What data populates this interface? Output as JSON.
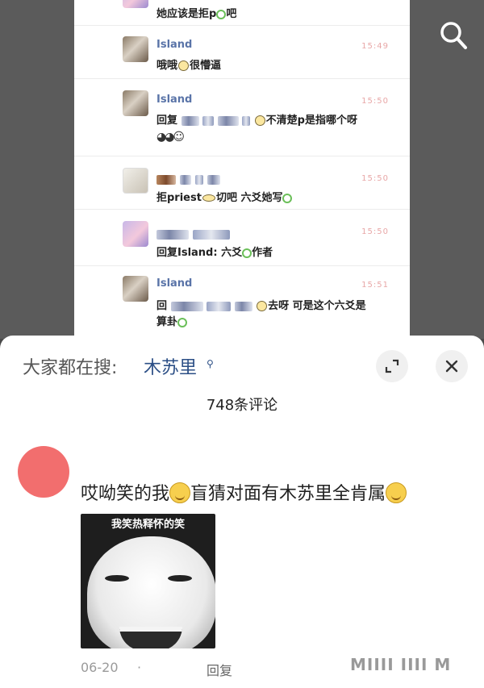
{
  "top_right": {
    "search_icon": "search-icon"
  },
  "chat": {
    "messages": [
      {
        "text": "她应该是拒p",
        "suffix": "吧"
      },
      {
        "user": "Island",
        "time": "15:49",
        "text_a": "哦哦",
        "text_b": "很懵逼"
      },
      {
        "user": "Island",
        "time": "15:50",
        "text_a": "回复",
        "text_b": "不清楚p是指哪个呀"
      },
      {
        "time": "15:50",
        "text_a": "拒priest",
        "text_b": "切吧 六爻她写"
      },
      {
        "time": "15:50",
        "text_a": "回复Island: 六爻",
        "text_b": "作者"
      },
      {
        "user": "Island",
        "time": "15:51",
        "text_a": "回",
        "text_b": "去呀 可是这个六爻是",
        "text_c": "算卦"
      }
    ]
  },
  "sheet": {
    "hot_prefix": "大家都在搜:",
    "hot_term": "木苏里",
    "expand_icon": "expand-icon",
    "close_icon": "close-icon",
    "comment_count": "748条评论"
  },
  "comment": {
    "text_a": "哎呦笑的我",
    "text_b": "盲猜对面有木苏里全肯属",
    "meme_caption": "我笑热释怀的笑",
    "date": "06-20",
    "dot": "·",
    "reply": "回复",
    "watermark": "ΜΙΙΙΙ ΙΙΙΙ Μ"
  },
  "colors": {
    "accent_blue": "#2c4f86",
    "avatar_red": "#f26e6e"
  }
}
